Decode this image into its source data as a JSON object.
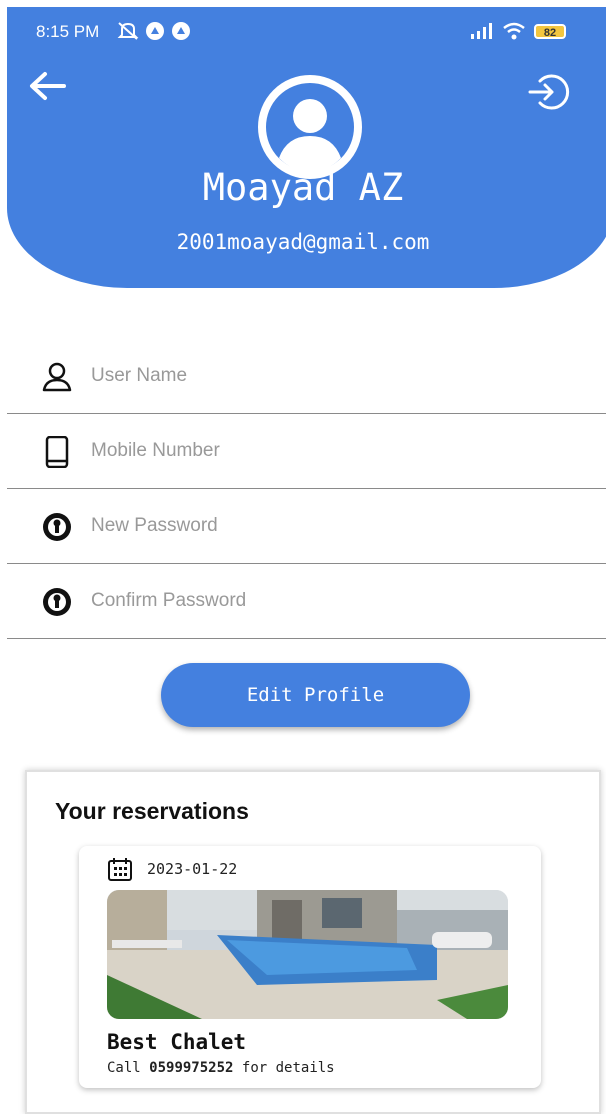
{
  "status_bar": {
    "time": "8:15 PM",
    "battery": "82"
  },
  "profile": {
    "name": "Moayad AZ",
    "email": "2001moayad@gmail.com"
  },
  "fields": [
    {
      "placeholder": "User Name",
      "icon": "person-icon"
    },
    {
      "placeholder": "Mobile Number",
      "icon": "phone-icon"
    },
    {
      "placeholder": "New Password",
      "icon": "key-icon"
    },
    {
      "placeholder": "Confirm Password",
      "icon": "key-icon"
    }
  ],
  "edit_button": "Edit Profile",
  "reservations": {
    "title": "Your reservations",
    "items": [
      {
        "date": "2023-01-22",
        "name": "Best Chalet",
        "call_prefix": "Call",
        "phone": "0599975252",
        "call_suffix": "for details"
      }
    ]
  },
  "colors": {
    "primary": "#4480df",
    "battery": "#f3c640"
  }
}
